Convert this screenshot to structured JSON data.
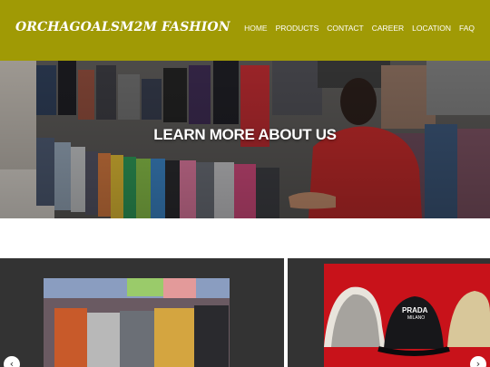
{
  "header": {
    "brand": "ORCHAGOALSM2M FASHION",
    "nav": [
      {
        "label": "HOME",
        "active": true
      },
      {
        "label": "PRODUCTS",
        "active": false
      },
      {
        "label": "CONTACT",
        "active": false
      },
      {
        "label": "CAREER",
        "active": false
      },
      {
        "label": "LOCATION",
        "active": false
      },
      {
        "label": "FAQ",
        "active": false
      }
    ]
  },
  "hero": {
    "title": "LEARN MORE ABOUT US"
  },
  "carousel": {
    "prev_icon": "chevron-left-icon",
    "next_icon": "chevron-right-icon",
    "hat_label_1": "PRADA",
    "hat_label_2": "MILANO"
  },
  "colors": {
    "header_bg": "#a09a05",
    "card_bg": "#333333",
    "red_backdrop": "#c8121a"
  }
}
